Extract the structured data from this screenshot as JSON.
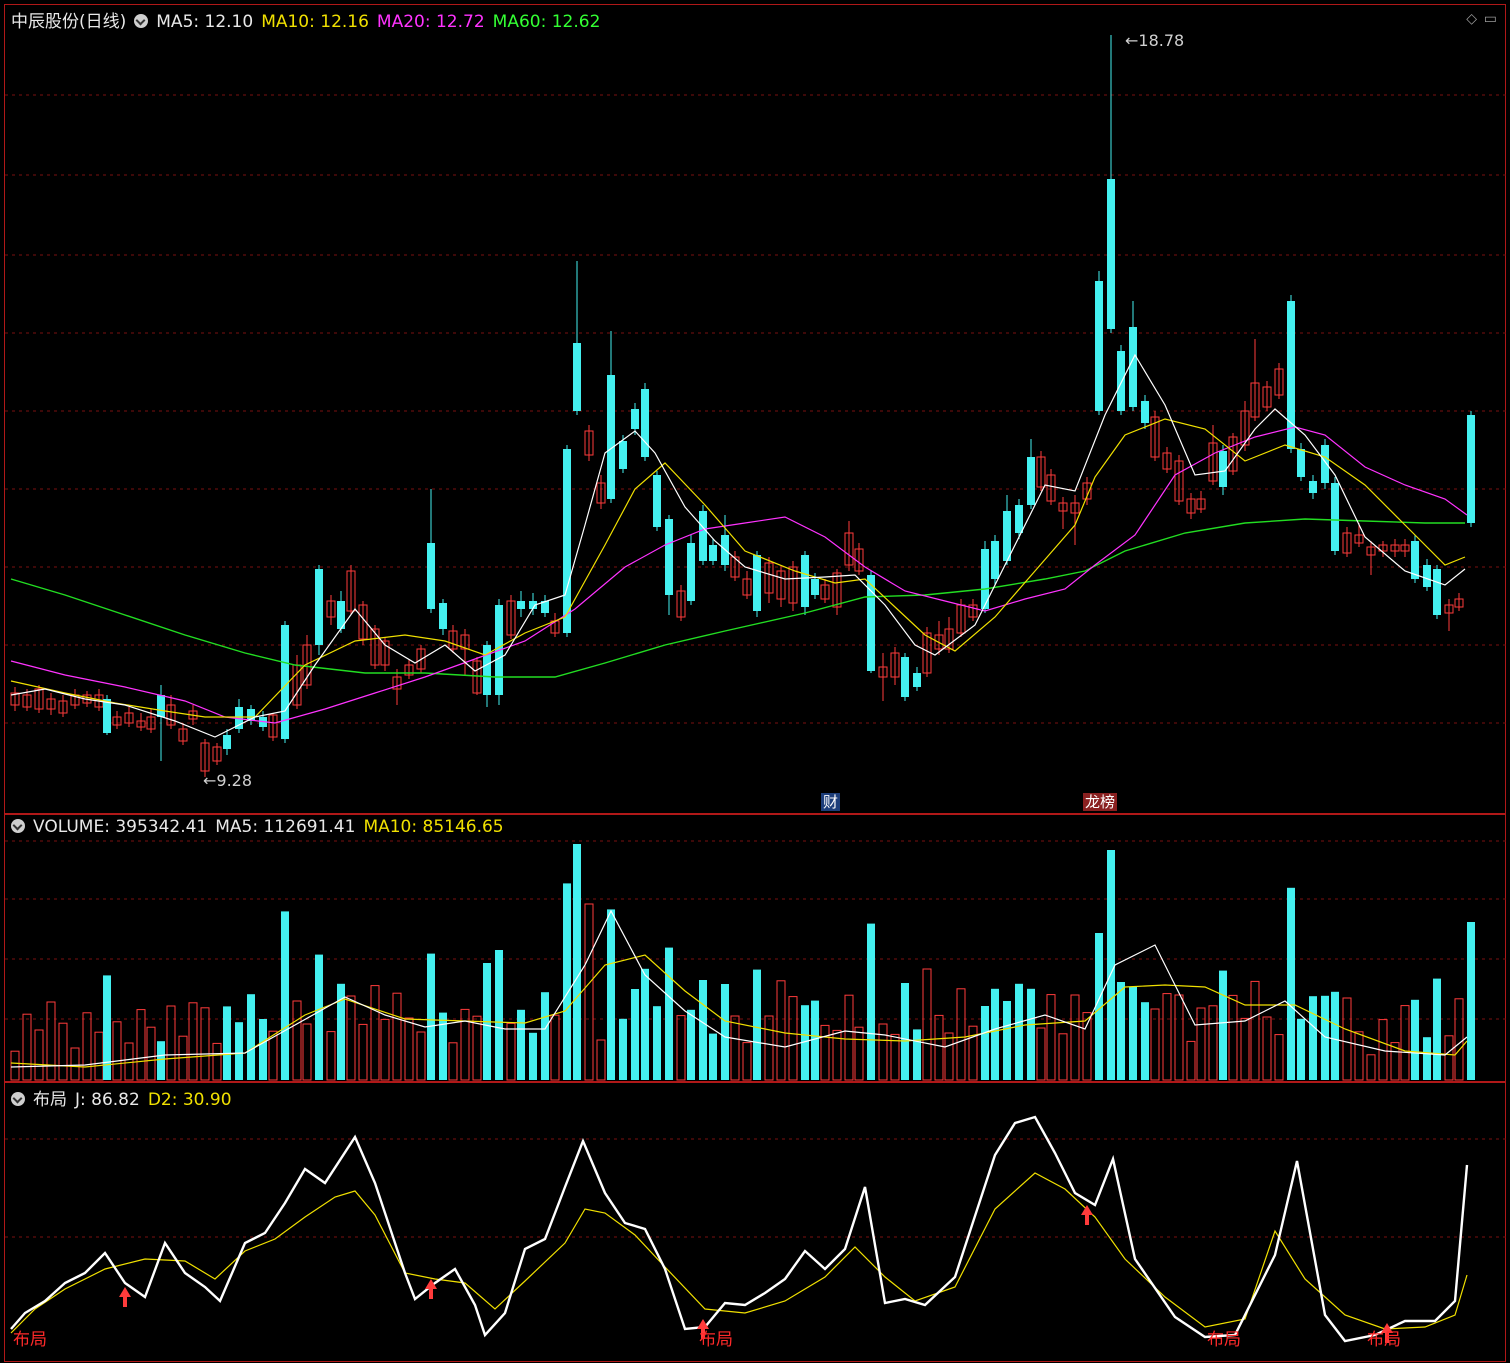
{
  "price_header": {
    "title": "中辰股份(日线)",
    "ma5": "MA5: 12.10",
    "ma10": "MA10: 12.16",
    "ma20": "MA20: 12.72",
    "ma60": "MA60: 12.62"
  },
  "price_marks": {
    "high": "18.78",
    "low": "9.28"
  },
  "event_badges": {
    "fin": "财",
    "rank": "龙榜"
  },
  "volume_header": {
    "volume": "VOLUME: 395342.41",
    "ma5": "MA5: 112691.41",
    "ma10": "MA10: 85146.65"
  },
  "indicator_header": {
    "name": "布局",
    "j": "J: 86.82",
    "d2": "D2: 30.90"
  },
  "signal_label": "布局",
  "corner_icons": [
    "diamond-icon",
    "window-icon"
  ],
  "colors": {
    "up": "#ff3b3b",
    "down": "#44f0f0",
    "ma5": "#ffffff",
    "ma10": "#f0e000",
    "ma20": "#ff33ff",
    "ma60": "#22dd22",
    "border": "#b01818",
    "grid": "#7a1010"
  }
}
